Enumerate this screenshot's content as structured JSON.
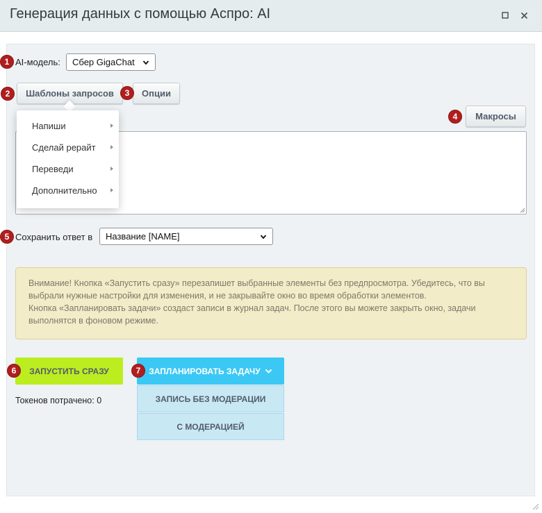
{
  "window": {
    "title": "Генерация данных с помощью Аспро: AI",
    "maximize_icon": "maximize-icon",
    "close_icon": "close-icon"
  },
  "badges": [
    "1",
    "2",
    "3",
    "4",
    "5",
    "6",
    "7"
  ],
  "model": {
    "label": "AI-модель:",
    "selected": "Сбер GigaChat"
  },
  "tabs": {
    "templates": "Шаблоны запросов",
    "options": "Опции"
  },
  "templates_menu": {
    "items": [
      {
        "label": "Напиши"
      },
      {
        "label": "Сделай рерайт"
      },
      {
        "label": "Переведи"
      },
      {
        "label": "Дополнительно"
      }
    ]
  },
  "macros_button": "Макросы",
  "prompt": {
    "value": ""
  },
  "save_to": {
    "label": "Сохранить ответ в",
    "selected": "Название [NAME]"
  },
  "warning": {
    "line1": "Внимание! Кнопка «Запустить сразу» перезапишет выбранные элементы без предпросмотра. Убедитесь, что вы выбрали нужные настройки для изменения, и не закрывайте окно во время обработки элементов.",
    "line2": "Кнопка «Запланировать задачи» создаст записи в журнал задач. После этого вы можете закрыть окно, задачи выполнятся в фоновом режиме."
  },
  "actions": {
    "run_now": "ЗАПУСТИТЬ СРАЗУ",
    "schedule": "ЗАПЛАНИРОВАТЬ ЗАДАЧУ",
    "schedule_no_moderation": "ЗАПИСЬ БЕЗ МОДЕРАЦИИ",
    "schedule_with_moderation": "С МОДЕРАЦИЕЙ"
  },
  "tokens": {
    "label": "Токенов потрачено: 0"
  },
  "colors": {
    "accent_green": "#bbed21",
    "accent_blue": "#3bc8f5",
    "badge_red": "#b01e1e",
    "warning_bg": "#f2ecc8"
  }
}
